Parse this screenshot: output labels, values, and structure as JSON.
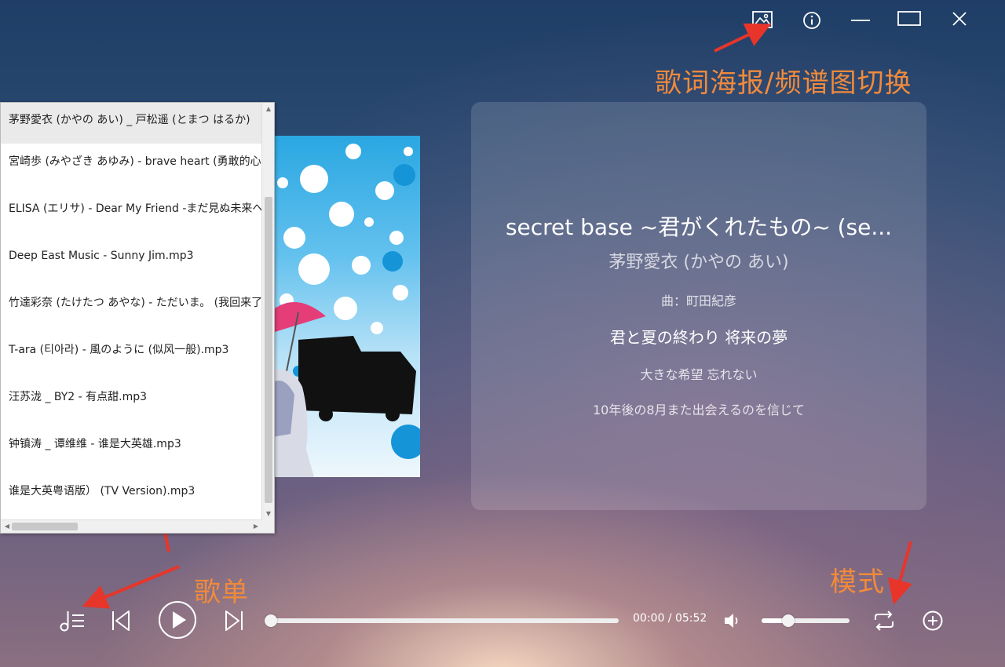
{
  "window_controls": [
    "poster-spectrum-toggle",
    "info",
    "minimize",
    "maximize",
    "close"
  ],
  "annotations": {
    "poster_toggle": "歌词海报/频谱图切换",
    "playlist": "歌单",
    "mode": "模式"
  },
  "now_playing": {
    "title": "secret base ~君がくれたもの~ (se...",
    "artist": "茅野愛衣 (かやの あい)",
    "composer": "曲：町田紀彦",
    "lyrics": [
      "君と夏の終わり 将来の夢",
      "大きな希望 忘れない",
      "10年後の8月また出会えるのを信じて"
    ]
  },
  "playlist": {
    "items": [
      "茅野愛衣 (かやの あい) _ 戸松遥 (とまつ はるか)",
      "宮崎歩 (みやざき あゆみ) - brave heart (勇敢的心)",
      "ELISA (エリサ) - Dear My Friend -まだ見ぬ未来へ",
      "Deep East Music - Sunny Jim.mp3",
      "竹達彩奈 (たけたつ あやな) - ただいま。 (我回来了)",
      "T-ara (티아라) - 風のように (似风一般).mp3",
      "汪苏泷 _ BY2 - 有点甜.mp3",
      "钟镇涛 _ 谭维维 - 谁是大英雄.mp3",
      "谁是大英粤语版） (TV Version).mp3"
    ],
    "selected_index": 0
  },
  "player": {
    "time": "00:00 / 05:52",
    "progress": 0,
    "volume": 0.3,
    "icons": [
      "playlist-icon",
      "previous-icon",
      "play-icon",
      "next-icon",
      "volume-icon",
      "repeat-icon",
      "add-icon"
    ]
  },
  "colors": {
    "annotation": "#f28a3a",
    "arrow": "#e8352a"
  }
}
